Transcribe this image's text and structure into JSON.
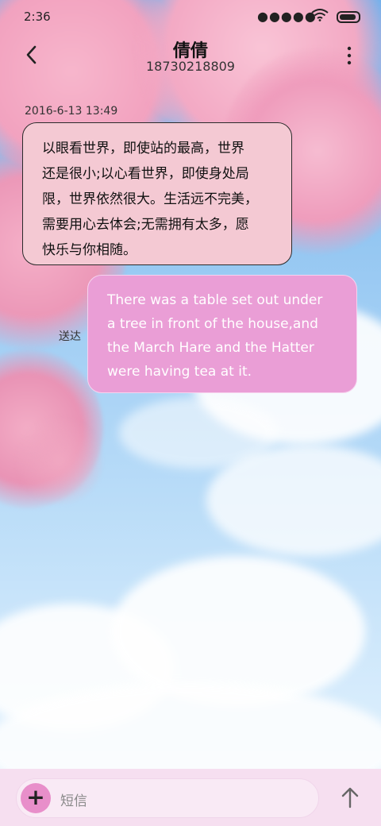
{
  "status_bar": {
    "time": "2:36",
    "signal_dots": "●●●●●",
    "wifi_icon": "wifi-icon",
    "battery_icon": "battery-icon"
  },
  "header": {
    "title": "倩倩",
    "subtitle": "18730218809",
    "back_icon": "back-arrow-icon",
    "more_icon": "more-vertical-icon"
  },
  "conversation": {
    "timestamp": "2016-6-13 13:49",
    "incoming": {
      "line1": "以眼看世界，即使站的最高，世界",
      "line2": "还是很小;以心看世界，即使身处局",
      "line3": "限，世界依然很大。生活远不完美，",
      "line4": "需要用心去体会;无需拥有太多，愿",
      "line5": "快乐与你相随。"
    },
    "outgoing": {
      "line1": "There was a table set out under",
      "line2": "a tree in front of the house,and",
      "line3": "the March Hare and the Hatter",
      "line4": "were having tea at it."
    },
    "delivery_status": "送达"
  },
  "composer": {
    "add_icon": "plus-icon",
    "add_symbol": "+",
    "placeholder": "短信",
    "send_icon": "send-arrow-icon"
  },
  "colors": {
    "incoming_bubble": "#f4c9d3",
    "outgoing_bubble": "#ea9ed6",
    "composer_bar": "#f6dff0",
    "plus_button": "#e88fca"
  }
}
